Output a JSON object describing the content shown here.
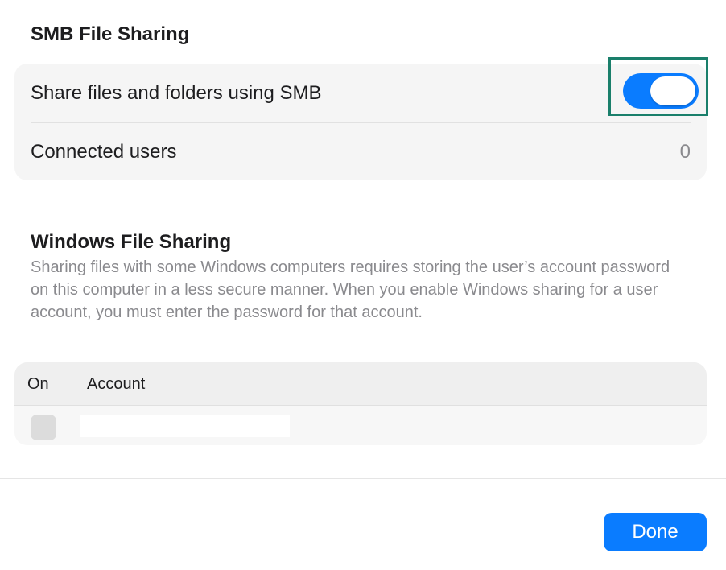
{
  "smb_section": {
    "title": "SMB File Sharing",
    "share_label": "Share files and folders using SMB",
    "share_enabled": true,
    "connected_users_label": "Connected users",
    "connected_users_value": "0"
  },
  "windows_section": {
    "title": "Windows File Sharing",
    "description": "Sharing files with some Windows computers requires storing the user’s account password on this computer in a less secure manner. When you enable Windows sharing for a user account, you must enter the password for that account.",
    "table": {
      "columns": [
        "On",
        "Account"
      ],
      "rows": [
        {
          "on": false,
          "account": ""
        }
      ]
    }
  },
  "footer": {
    "done_label": "Done"
  },
  "colors": {
    "accent": "#0a7cff",
    "highlight_border": "#1a7f6b"
  }
}
